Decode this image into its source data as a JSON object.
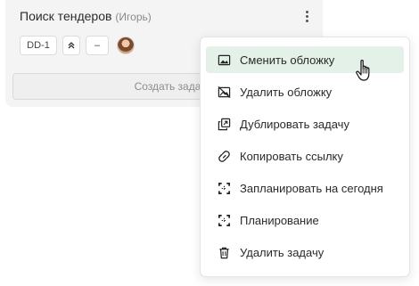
{
  "card": {
    "title": "Поиск тендеров",
    "owner": "(Игорь)",
    "chips": {
      "id": "DD-1",
      "priority": "≪",
      "dash": "–"
    },
    "create_task": "Создать задач"
  },
  "menu": {
    "items": [
      {
        "label": "Сменить обложку",
        "icon": "image-icon"
      },
      {
        "label": "Удалить обложку",
        "icon": "image-off-icon"
      },
      {
        "label": "Дублировать задачу",
        "icon": "duplicate-icon"
      },
      {
        "label": "Копировать ссылку",
        "icon": "link-icon"
      },
      {
        "label": "Запланировать на сегодня",
        "icon": "focus-frame-icon"
      },
      {
        "label": "Планирование",
        "icon": "focus-frame-icon"
      },
      {
        "label": "Удалить задачу",
        "icon": "trash-icon"
      }
    ]
  },
  "colors": {
    "active_bg": "#e3f1e8",
    "card_bg": "#f4f4f5"
  }
}
